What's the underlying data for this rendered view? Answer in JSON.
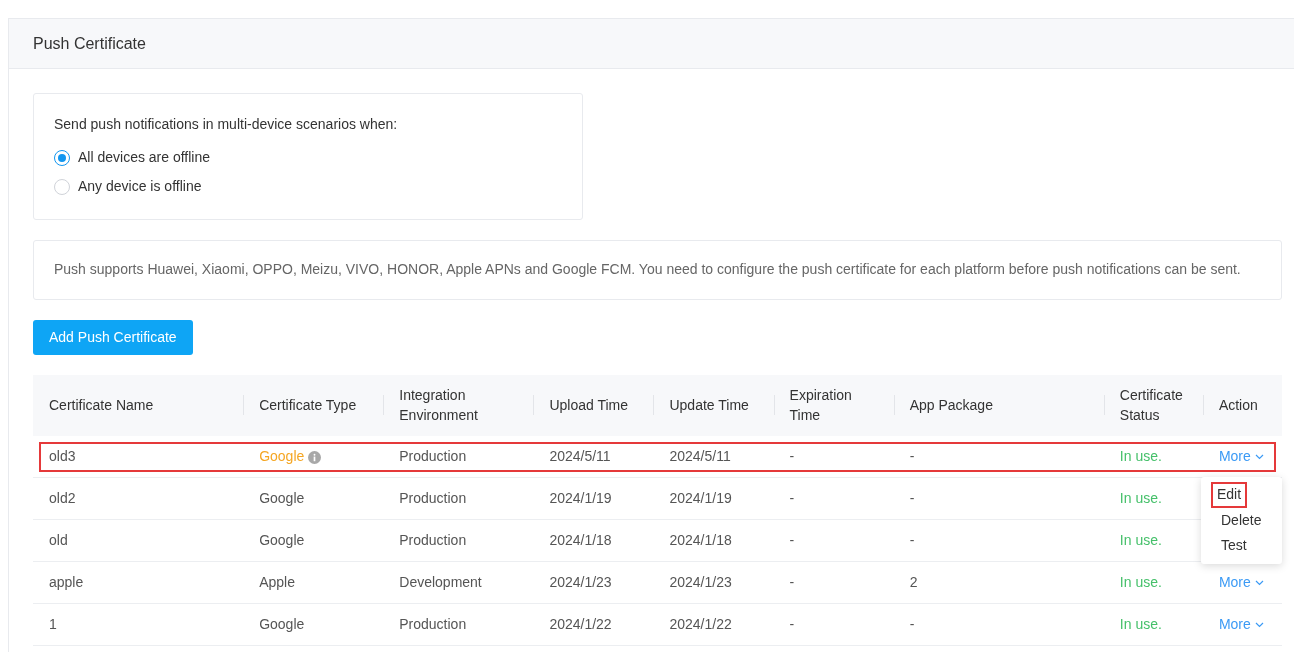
{
  "panel": {
    "title": "Push Certificate"
  },
  "policy": {
    "prompt": "Send push notifications in multi-device scenarios when:",
    "options": [
      {
        "label": "All devices are offline",
        "selected": true
      },
      {
        "label": "Any device is offline",
        "selected": false
      }
    ]
  },
  "notice": "Push supports Huawei, Xiaomi, OPPO, Meizu, VIVO, HONOR, Apple APNs and Google FCM. You need to configure the push certificate for each platform before push notifications can be sent.",
  "add_button": "Add Push Certificate",
  "table": {
    "columns": [
      "Certificate Name",
      "Certificate Type",
      "Integration Environment",
      "Upload Time",
      "Update Time",
      "Expiration Time",
      "App Package",
      "Certificate Status",
      "Action"
    ],
    "rows": [
      {
        "name": "old3",
        "type": "Google",
        "flagged": true,
        "environment": "Production",
        "upload_time": "2024/5/11",
        "update_time": "2024/5/11",
        "expiration_time": "-",
        "app_package": "-",
        "status": "In use.",
        "action": "More",
        "highlighted": true,
        "expanded": true,
        "menu": [
          {
            "label": "Edit",
            "highlighted": true
          },
          {
            "label": "Delete",
            "highlighted": false
          },
          {
            "label": "Test",
            "highlighted": false
          }
        ]
      },
      {
        "name": "old2",
        "type": "Google",
        "flagged": false,
        "environment": "Production",
        "upload_time": "2024/1/19",
        "update_time": "2024/1/19",
        "expiration_time": "-",
        "app_package": "-",
        "status": "In use.",
        "highlighted": false,
        "expanded": false
      },
      {
        "name": "old",
        "type": "Google",
        "flagged": false,
        "environment": "Production",
        "upload_time": "2024/1/18",
        "update_time": "2024/1/18",
        "expiration_time": "-",
        "app_package": "-",
        "status": "In use.",
        "highlighted": false,
        "expanded": false
      },
      {
        "name": "apple",
        "type": "Apple",
        "flagged": false,
        "environment": "Development",
        "upload_time": "2024/1/23",
        "update_time": "2024/1/23",
        "expiration_time": "-",
        "app_package": "2",
        "status": "In use.",
        "action": "More",
        "highlighted": false,
        "expanded": false
      },
      {
        "name": "1",
        "type": "Google",
        "flagged": false,
        "environment": "Production",
        "upload_time": "2024/1/22",
        "update_time": "2024/1/22",
        "expiration_time": "-",
        "app_package": "-",
        "status": "In use.",
        "action": "More",
        "highlighted": false,
        "expanded": false
      }
    ]
  }
}
